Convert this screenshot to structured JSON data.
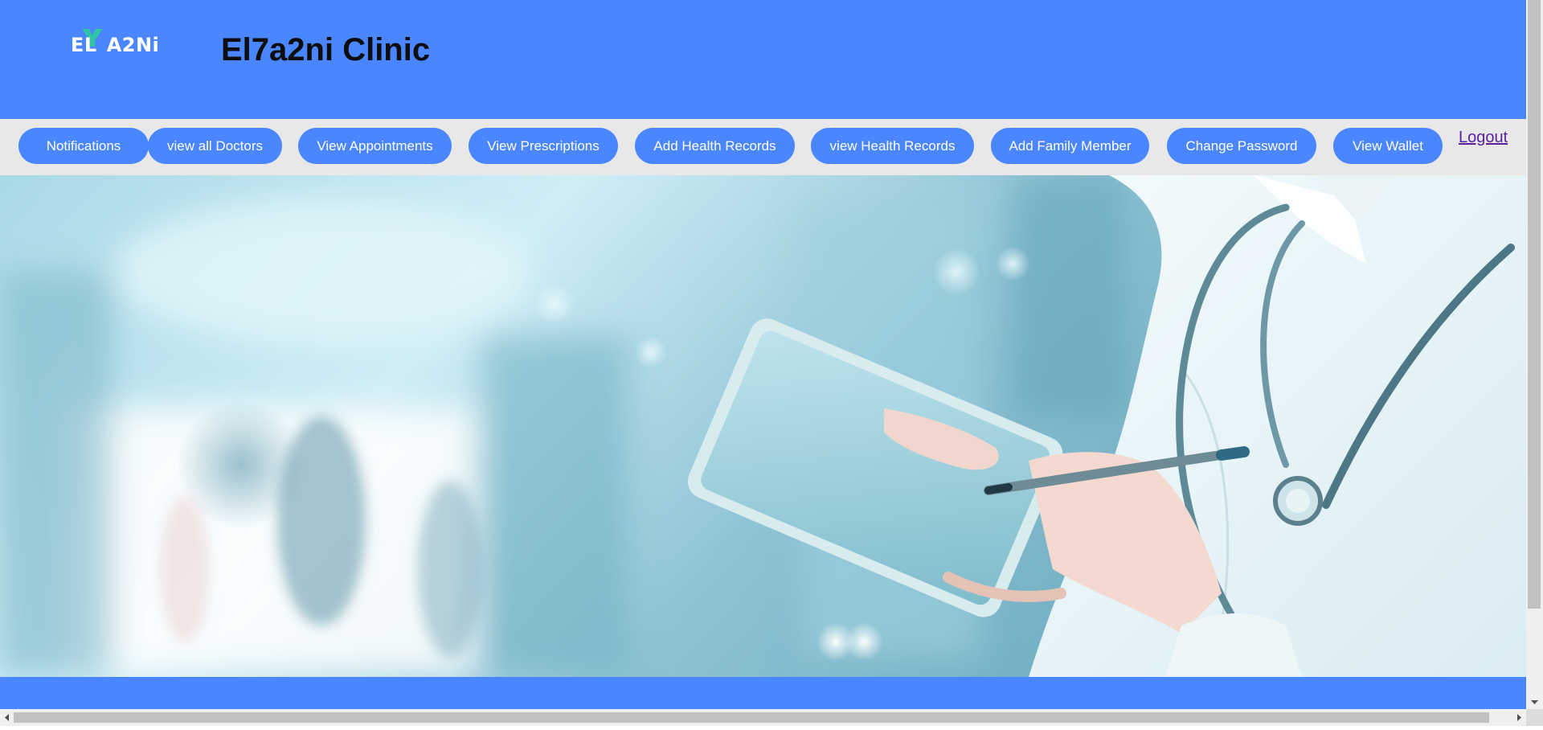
{
  "brand": {
    "logo_text_left": "EL",
    "logo_text_right": "A2Ni",
    "title": "El7a2ni Clinic",
    "header_color": "#4a86ff",
    "logo_accent_color": "#2ec4a6"
  },
  "nav": {
    "buttons": [
      {
        "label": "Notifications"
      },
      {
        "label": "view all Doctors"
      },
      {
        "label": "View Appointments"
      },
      {
        "label": "View Prescriptions"
      },
      {
        "label": "Add Health Records"
      },
      {
        "label": "view Health Records"
      },
      {
        "label": "Add Family Member"
      },
      {
        "label": "Change Password"
      },
      {
        "label": "View Wallet"
      }
    ],
    "logout_label": "Logout",
    "bar_color": "#e8e8e8",
    "button_color": "#4a86ff"
  },
  "hero": {
    "image_subject": "doctor-with-tablet-image"
  }
}
